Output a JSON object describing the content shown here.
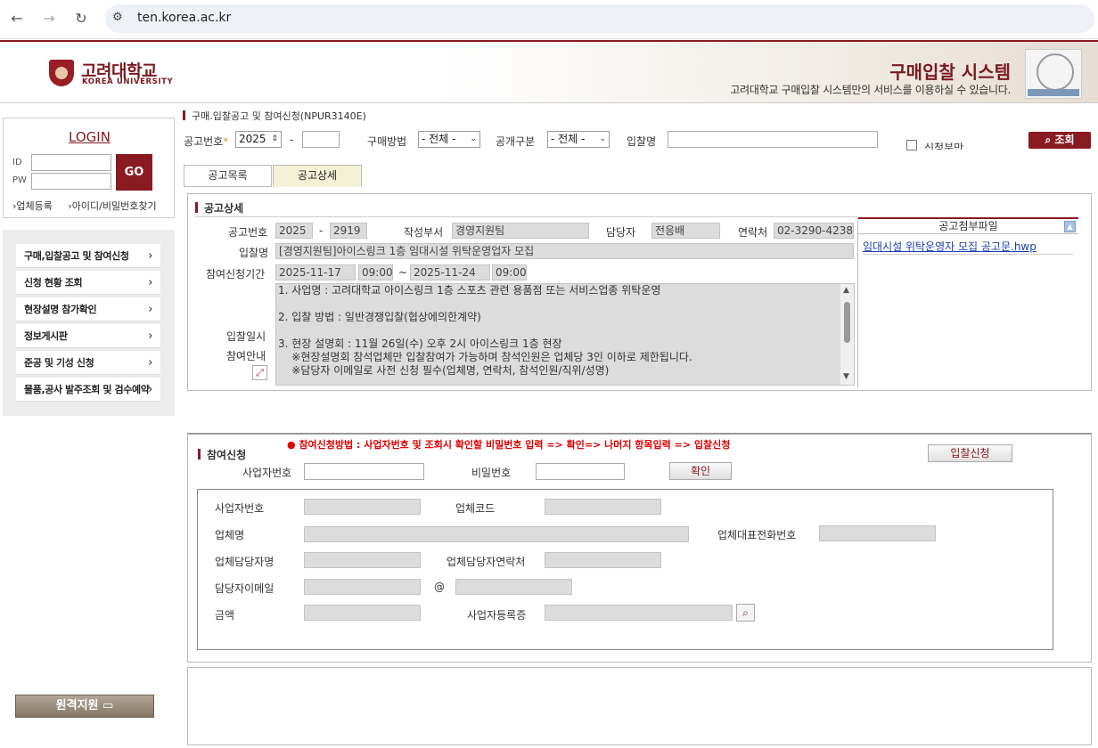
{
  "browser": {
    "url": "ten.korea.ac.kr",
    "back_icon": "←",
    "forward_icon": "→",
    "reload_icon": "↻",
    "site_settings_icon": "⚙"
  },
  "header": {
    "univ_name_kr": "고려대학교",
    "univ_name_en": "KOREA UNIVERSITY",
    "system_title": "구매입찰 시스템",
    "system_subtitle": "고려대학교 구매입찰 시스템만의 서비스를 이용하실 수 있습니다."
  },
  "login": {
    "title": "LOGIN",
    "id_label": "ID",
    "pw_label": "PW",
    "go_label": "GO",
    "register_link": "업체등록",
    "find_link": "아이디/비밀번호찾기"
  },
  "menu": {
    "items": [
      {
        "label": "구매,입찰공고 및 참여신청"
      },
      {
        "label": "신청 현황 조회"
      },
      {
        "label": "현장설명 참가확인"
      },
      {
        "label": "정보게시판"
      },
      {
        "label": "준공 및 기성 신청"
      },
      {
        "label": "물품,공사 발주조회 및 검수예약"
      }
    ],
    "chevron": "›"
  },
  "remote_support": "원격지원",
  "breadcrumb": "구매.입찰공고 및 참여신청(NPUR3140E)",
  "search": {
    "notice_no_label": "공고번호",
    "required_mark": "*",
    "year": "2025",
    "dash": "-",
    "purchase_method_label": "구매방법",
    "purchase_method_value": "- 전체 -",
    "open_type_label": "공개구분",
    "open_type_value": "- 전체 -",
    "bid_name_label": "입찰명",
    "apply_only_label": "신청분만",
    "search_button": "조회",
    "dropdown_icon": "⌄",
    "spinner_icon": "⇕"
  },
  "tabs": [
    {
      "label": "공고목록"
    },
    {
      "label": "공고상세"
    }
  ],
  "detail": {
    "section_title": "공고상세",
    "notice_no_label": "공고번호",
    "notice_year": "2025",
    "notice_dash": "-",
    "notice_no": "2919",
    "dept_label": "작성부서",
    "dept_value": "경영지원팀",
    "manager_label": "담당자",
    "manager_value": "전응배",
    "contact_label": "연락처",
    "contact_value": "02-3290-4238",
    "bid_name_label": "입찰명",
    "bid_name_value": "[경영지원팀]아이스링크 1층 임대시설 위탁운영업자 모집",
    "period_label": "참여신청기간",
    "start_date": "2025-11-17",
    "start_time": "09:00",
    "tilde": "~",
    "end_date": "2025-11-24",
    "end_time": "09:00",
    "bid_date_label": "입찰일시",
    "guide_label": "참여안내",
    "notice_lines": [
      "1. 사업명 : 고려대학교 아이스링크 1층 스포츠 관련 용품점 또는 서비스업종 위탁운영",
      "",
      "2. 입찰 방법 : 일반경쟁입찰(협상에의한계약)",
      "",
      "3. 현장 설명회 : 11월 26일(수) 오후 2시 아이스링크 1층 현장",
      "    ※현장설명회 참석업체만 입찰참여가 가능하며 참석인원은 업체당 3인 이하로 제한됩니다.",
      "    ※담당자 이메일로 사전 신청 필수(업체명, 연락처, 참석인원/직위/성명)"
    ],
    "attach_title": "공고첨부파일",
    "attach_file": "임대시설 위탁운영자 모집 공고문.hwp"
  },
  "apply": {
    "section_title": "참여신청",
    "method_notice": "● 참여신청방법 : 사업자번호 및 조회시 확인할 비밀번호 입력 => 확인=> 나머지 항목입력 => 입찰신청",
    "apply_button": "입찰신청",
    "biz_no_label": "사업자번호",
    "password_label": "비밀번호",
    "confirm_button": "확인",
    "fields": {
      "biz_no": "사업자번호",
      "company_code": "업체코드",
      "company_name": "업체명",
      "company_phone": "업체대표전화번호",
      "contact_name": "업체담당자명",
      "contact_phone": "업체담당자연락처",
      "contact_email": "담당자이메일",
      "at": "@",
      "amount": "금액",
      "biz_cert": "사업자등록증"
    }
  }
}
